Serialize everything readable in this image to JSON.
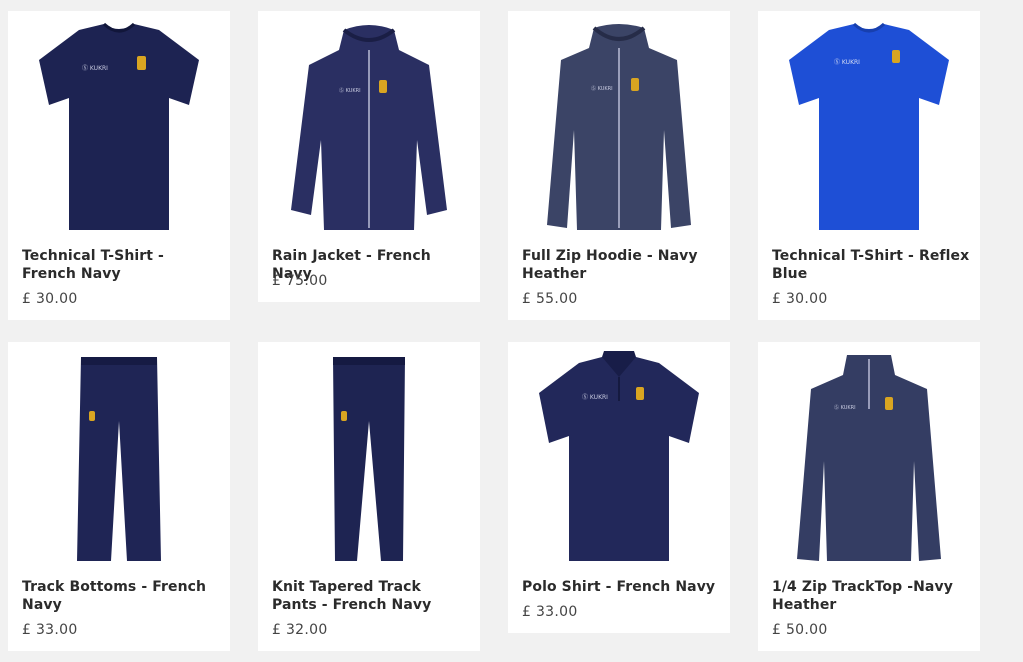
{
  "products": [
    {
      "title": "Technical T-Shirt - French Navy",
      "price": "£ 30.00",
      "kind": "tshirt",
      "color": "#1d2352"
    },
    {
      "title": "Rain Jacket - French Navy",
      "price": "£ 75.00",
      "kind": "jacket",
      "color": "#2a2f62"
    },
    {
      "title": "Full Zip Hoodie - Navy Heather",
      "price": "£ 55.00",
      "kind": "hoodie",
      "color": "#3b4466"
    },
    {
      "title": "Technical T-Shirt - Reflex Blue",
      "price": "£ 30.00",
      "kind": "tshirt",
      "color": "#1e4fd6"
    },
    {
      "title": "Track Bottoms - French Navy",
      "price": "£ 33.00",
      "kind": "pants",
      "color": "#1f2555"
    },
    {
      "title": "Knit Tapered Track Pants - French Navy",
      "price": "£ 32.00",
      "kind": "pants",
      "color": "#1e2452"
    },
    {
      "title": "Polo Shirt - French Navy",
      "price": "£ 33.00",
      "kind": "polo",
      "color": "#22285a"
    },
    {
      "title": "1/4 Zip TrackTop -Navy Heather",
      "price": "£ 50.00",
      "kind": "quarterzip",
      "color": "#343d63"
    }
  ],
  "crest_color": "#d9a521",
  "background_color": "#f1f1f1"
}
